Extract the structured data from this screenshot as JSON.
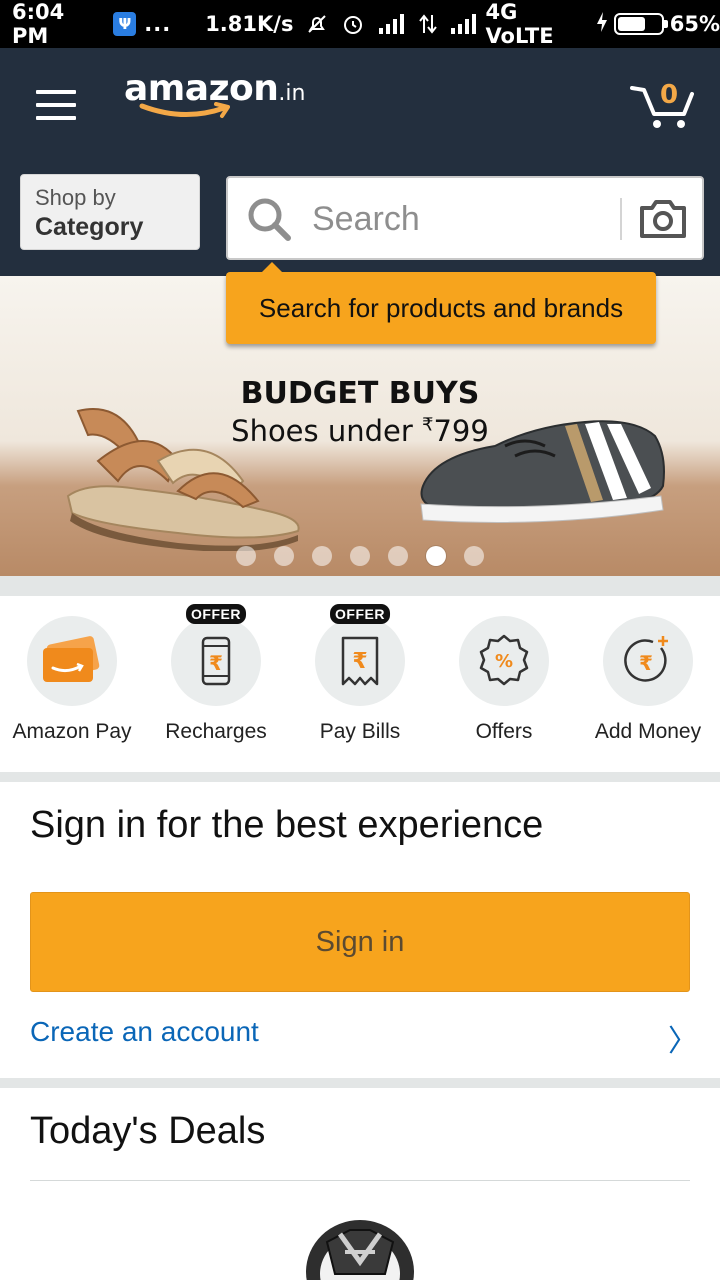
{
  "status_bar": {
    "time": "6:04 PM",
    "dots": "...",
    "speed": "1.81K/s",
    "network": "4G VoLTE",
    "battery": "65%",
    "battery_level": 0.65
  },
  "header": {
    "logo": "amazon",
    "logo_suffix": ".in",
    "cart_count": "0",
    "shop_by_line1": "Shop by",
    "shop_by_line2": "Category",
    "search_placeholder": "Search",
    "tooltip": "Search for products and brands"
  },
  "banner": {
    "title": "BUDGET BUYS",
    "subtitle_prefix": "Shoes under ",
    "currency": "₹",
    "price": "799",
    "slide_count": 7,
    "active_slide": 6
  },
  "quick_actions": [
    {
      "label": "Amazon Pay",
      "icon": "amazon-pay-icon",
      "offer": ""
    },
    {
      "label": "Recharges",
      "icon": "phone-recharge-icon",
      "offer": "OFFER"
    },
    {
      "label": "Pay Bills",
      "icon": "bill-receipt-icon",
      "offer": "OFFER"
    },
    {
      "label": "Offers",
      "icon": "percent-badge-icon",
      "offer": ""
    },
    {
      "label": "Add Money",
      "icon": "add-money-icon",
      "offer": ""
    }
  ],
  "signin": {
    "title": "Sign in for the best experience",
    "button": "Sign in",
    "create_account": "Create an account",
    "chevron": "〉"
  },
  "deals": {
    "title": "Today's Deals"
  },
  "colors": {
    "header_bg": "#232f3e",
    "accent_orange": "#f7a41d",
    "link_blue": "#0a66b7",
    "cart_orange": "#f3a847"
  }
}
